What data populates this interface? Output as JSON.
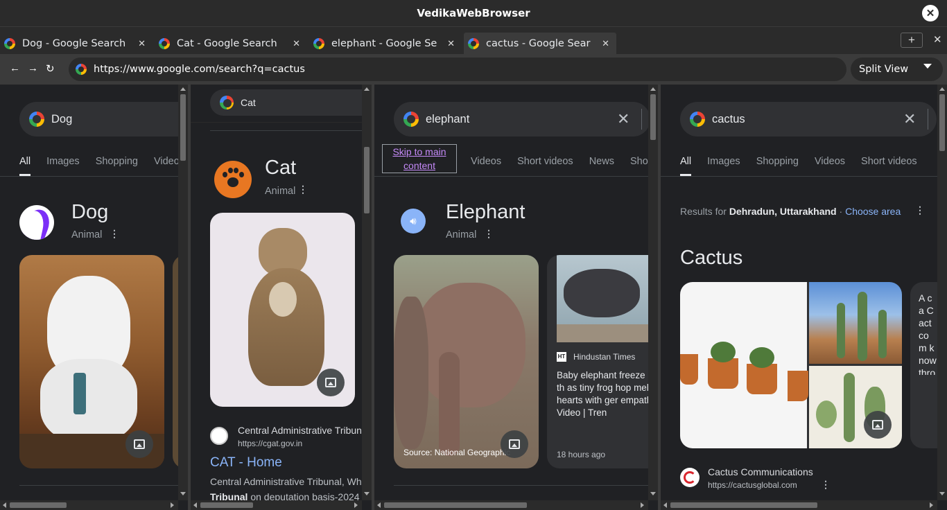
{
  "window": {
    "title": "VedikaWebBrowser",
    "close_glyph": "✕"
  },
  "tabs": [
    {
      "label": "Dog - Google Search",
      "active": false
    },
    {
      "label": "Cat - Google Search",
      "active": false
    },
    {
      "label": "elephant - Google Se",
      "active": false
    },
    {
      "label": "cactus - Google Sear",
      "active": true
    }
  ],
  "tab_close_glyph": "✕",
  "new_tab_glyph": "+",
  "nav": {
    "back": "←",
    "forward": "→",
    "reload": "↻",
    "url": "https://www.google.com/search?q=cactus",
    "view_mode": "Split View"
  },
  "colors": {
    "page_bg": "#202124",
    "link_blue": "#8ab4f8",
    "chrome_bg": "#2b2b2b"
  },
  "panes": {
    "dog": {
      "query": "Dog",
      "search_tabs": [
        "All",
        "Images",
        "Shopping",
        "Video"
      ],
      "kp_title": "Dog",
      "kp_subtitle": "Animal"
    },
    "cat": {
      "query": "Cat",
      "kp_title": "Cat",
      "kp_subtitle": "Animal",
      "result_site": "Central Administrative Tribun",
      "result_url": "https://cgat.gov.in",
      "result_title": "CAT - Home",
      "snippet_line1": "Central Administrative Tribunal, Wh",
      "snippet_bold": "Tribunal",
      "snippet_line2": " on deputation basis-2024"
    },
    "elephant": {
      "query": "elephant",
      "skip_link": "Skip to main content",
      "search_tabs": [
        "Videos",
        "Short videos",
        "News",
        "Sho"
      ],
      "kp_title": "Elephant",
      "kp_subtitle": "Animal",
      "image_source": "Source: National Geographic",
      "news_source": "Hindustan Times",
      "news_logo": "HT",
      "news_text": "Baby elephant freeze bath as tiny frog hop melts hearts with ger empathy. Video | Tren",
      "news_time": "18 hours ago"
    },
    "cactus": {
      "query": "cactus",
      "search_tabs": [
        "All",
        "Images",
        "Shopping",
        "Videos",
        "Short videos"
      ],
      "results_for": "Results for ",
      "location": "Dehradun, Uttarakhand",
      "separator": " · ",
      "choose_area": "Choose area",
      "kp_title": "Cactus",
      "desc_text": "A ca Cact com know throu κάκτ",
      "result_site": "Cactus Communications",
      "result_url": "https://cactusglobal.com"
    }
  }
}
